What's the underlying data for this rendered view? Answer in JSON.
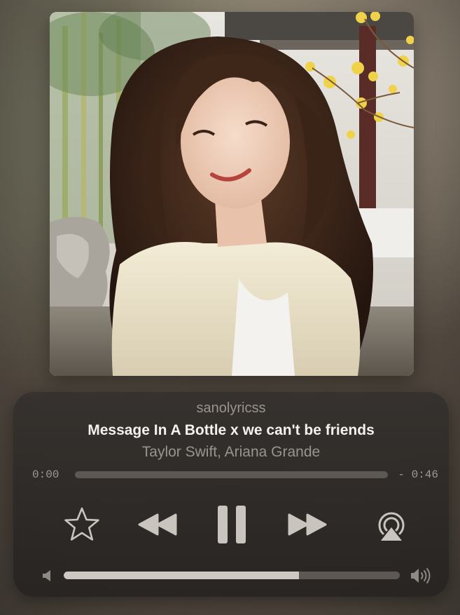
{
  "artwork": {
    "alt": "Album artwork photo"
  },
  "now_playing": {
    "source": "sanolyricss",
    "title": "Message In A Bottle x we can't be friends",
    "artist": "Taylor Swift, Ariana Grande"
  },
  "playback": {
    "elapsed": "0:00",
    "remaining": "- 0:46",
    "progress_fraction": 0.0,
    "state": "playing"
  },
  "volume": {
    "level_fraction": 0.7
  },
  "icons": {
    "favorite": "star-icon",
    "previous": "rewind-icon",
    "play_pause": "pause-icon",
    "next": "fast-forward-icon",
    "output": "airplay-icon",
    "volume_low": "speaker-low-icon",
    "volume_high": "speaker-high-icon"
  },
  "colors": {
    "panel": "#2f2c2a",
    "title": "#f4f1ee",
    "secondary_text": "#9a948e",
    "track": "#5d5853",
    "fill": "#cfcac4",
    "icon": "#c9c4be"
  }
}
